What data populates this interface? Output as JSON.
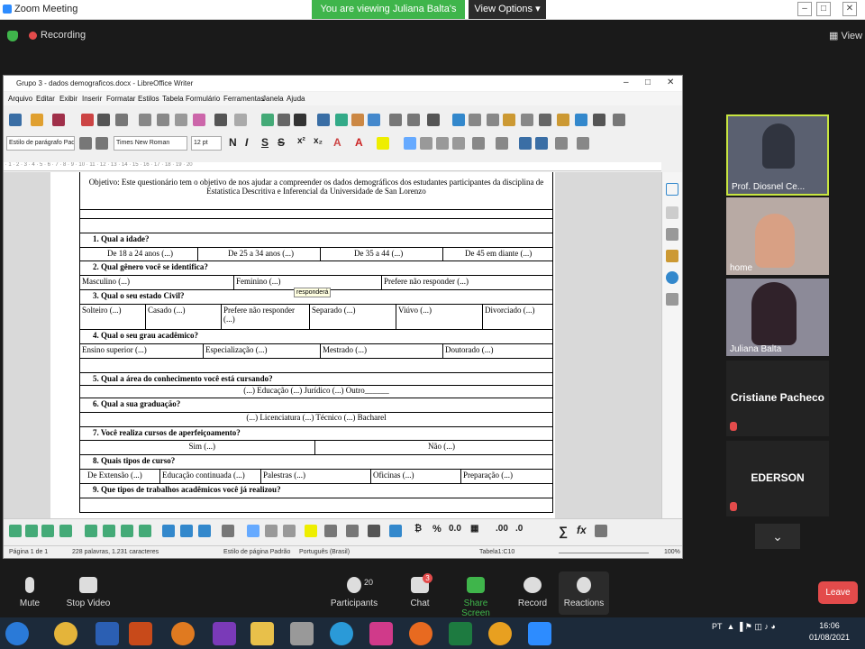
{
  "zoom": {
    "title": "Zoom Meeting",
    "viewing": "You are viewing Juliana  Balta's screen",
    "view_options": "View Options",
    "recording": "Recording",
    "view": "View"
  },
  "writer": {
    "title": "Grupo 3 - dados demograficos.docx - LibreOffice Writer",
    "menu": [
      "Arquivo",
      "Editar",
      "Exibir",
      "Inserir",
      "Formatar",
      "Estilos",
      "Tabela",
      "Formulário",
      "Ferramentas",
      "Janela",
      "Ajuda"
    ],
    "para_style": "Estilo de parágrafo Padrão",
    "font": "Times New Roman",
    "size": "12 pt",
    "status": {
      "page": "Página 1 de 1",
      "words": "228 palavras, 1.231 caracteres",
      "page_style": "Estilo de página Padrão",
      "lang": "Português (Brasil)",
      "cell": "Tabela1:C10",
      "zoom": "100%"
    }
  },
  "doc": {
    "intro": "Objetivo: Este questionário tem o objetivo de nos ajudar a compreender os dados demográficos dos estudantes participantes da disciplina de Estatistica Descritiva e Inferencial da Universidade de San Lorenzo",
    "q1": "1.   Qual a idade?",
    "q1a": [
      "De 18 a 24 anos (...)",
      "De 25 a 34 anos (...)",
      "De 35 a 44  (...)",
      "De 45 em diante (...)"
    ],
    "q2": "2.   Qual gênero você se identifica?",
    "q2a": [
      "Masculino (...)",
      "Feminino (...)",
      "Prefere não responder (...)"
    ],
    "tooltip": "responderá",
    "q3": "3.   Qual o seu estado Civil?",
    "q3a": [
      "Solteiro (...)",
      "Casado (...)",
      "Prefere não responder (...)",
      "Separado  (...)",
      "Viúvo (...)",
      "Divorciado (...)"
    ],
    "q4": "4.   Qual o seu grau acadêmico?",
    "q4a": [
      "Ensino superior (...)",
      "Especialização (...)",
      "Mestrado (...)",
      "Doutorado (...)"
    ],
    "q5": "5.   Qual a área do conhecimento você está cursando?",
    "q5a": "(...) Educação (...) Jurídico (...) Outro______",
    "q6": "6.   Qual a sua graduação?",
    "q6a": "(...) Licenciatura  (...) Técnico (...) Bacharel",
    "q7": "7.   Você realiza cursos de aperfeiçoamento?",
    "q7a": [
      "Sim (...)",
      "Não (...)"
    ],
    "q8": "8.   Quais tipos de curso?",
    "q8a": [
      "De Extensão (...)",
      "Educação continuada (...)",
      "Palestras  (...)",
      "Oficinas (...)",
      "Preparação (...)"
    ],
    "q9": "9.   Que tipos de trabalhos acadêmicos você já realizou?"
  },
  "participants": [
    {
      "name": "Prof. Diosnel Ce...",
      "type": "video"
    },
    {
      "name": "home",
      "type": "video"
    },
    {
      "name": "Juliana  Balta",
      "type": "video"
    },
    {
      "name": "Cristiane Pacheco",
      "type": "avatar"
    },
    {
      "name": "EDERSON",
      "type": "avatar"
    }
  ],
  "controls": [
    {
      "label": "Mute"
    },
    {
      "label": "Stop Video"
    },
    {
      "label": "Participants",
      "count": "20"
    },
    {
      "label": "Chat",
      "badge": "3"
    },
    {
      "label": "Share Screen"
    },
    {
      "label": "Record"
    },
    {
      "label": "Reactions"
    }
  ],
  "leave": "Leave",
  "taskbar": {
    "lang": "PT",
    "time": "16:06",
    "date": "01/08/2021"
  }
}
